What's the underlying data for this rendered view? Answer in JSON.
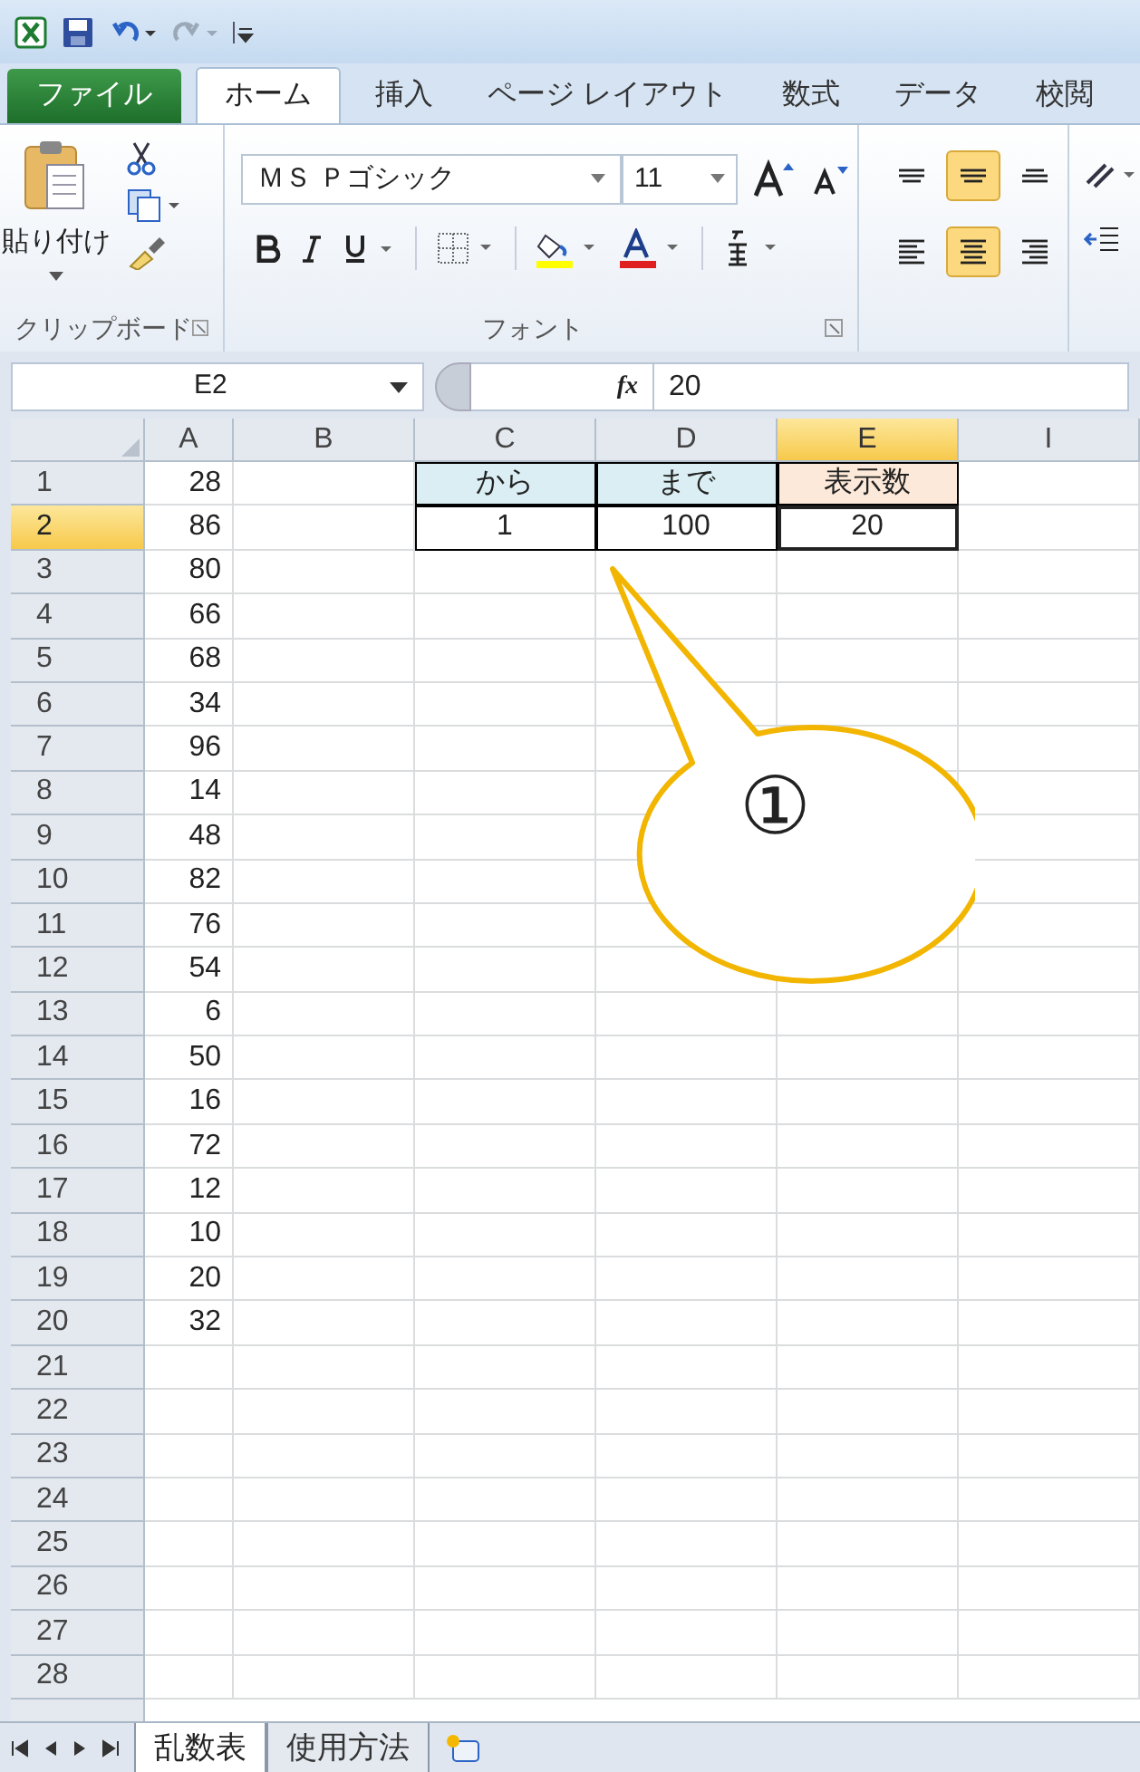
{
  "ribbon_tabs": [
    {
      "label": "ファイル",
      "kind": "file",
      "selected": false
    },
    {
      "label": "ホーム",
      "kind": "tab",
      "selected": true
    },
    {
      "label": "挿入",
      "kind": "tab",
      "selected": false
    },
    {
      "label": "ページ レイアウト",
      "kind": "tab",
      "selected": false
    },
    {
      "label": "数式",
      "kind": "tab",
      "selected": false
    },
    {
      "label": "データ",
      "kind": "tab",
      "selected": false
    },
    {
      "label": "校閲",
      "kind": "tab",
      "selected": false
    }
  ],
  "clipboard": {
    "paste_label": "貼り付け",
    "group_label": "クリップボード"
  },
  "font": {
    "name": "ＭＳ Ｐゴシック",
    "size": "11",
    "group_label": "フォント"
  },
  "alignment": [
    {
      "kind": "top",
      "selected": false
    },
    {
      "kind": "middle",
      "selected": true
    },
    {
      "kind": "bottom",
      "selected": false
    },
    {
      "kind": "left",
      "selected": false
    },
    {
      "kind": "center",
      "selected": true
    },
    {
      "kind": "right",
      "selected": false
    }
  ],
  "formula_bar": {
    "name_box": "E2",
    "function_label": "fx",
    "value": "20"
  },
  "grid": {
    "columns": [
      {
        "label": "A",
        "selected": false
      },
      {
        "label": "B",
        "selected": false
      },
      {
        "label": "C",
        "selected": false
      },
      {
        "label": "D",
        "selected": false
      },
      {
        "label": "E",
        "selected": true
      },
      {
        "label": "I",
        "selected": false
      }
    ],
    "rows": [
      {
        "label": "1",
        "selected": false,
        "cells": {
          "A": {
            "text": "28",
            "boxed": false
          },
          "C": {
            "text": "から",
            "boxed": true,
            "color": "#daeef3"
          },
          "D": {
            "text": "まで",
            "boxed": true,
            "color": "#daeef3"
          },
          "E": {
            "text": "表示数",
            "boxed": true,
            "color": "#fde9d9"
          }
        }
      },
      {
        "label": "2",
        "selected": true,
        "cells": {
          "A": {
            "text": "86",
            "boxed": false
          },
          "C": {
            "text": "1",
            "boxed": true
          },
          "D": {
            "text": "100",
            "boxed": true
          },
          "E": {
            "text": "20",
            "boxed": true,
            "selected": true
          }
        }
      },
      {
        "label": "3",
        "selected": false,
        "cells": {
          "A": {
            "text": "80",
            "boxed": false
          }
        }
      },
      {
        "label": "4",
        "selected": false,
        "cells": {
          "A": {
            "text": "66",
            "boxed": false
          }
        }
      },
      {
        "label": "5",
        "selected": false,
        "cells": {
          "A": {
            "text": "68",
            "boxed": false
          }
        }
      },
      {
        "label": "6",
        "selected": false,
        "cells": {
          "A": {
            "text": "34",
            "boxed": false
          }
        }
      },
      {
        "label": "7",
        "selected": false,
        "cells": {
          "A": {
            "text": "96",
            "boxed": false
          }
        }
      },
      {
        "label": "8",
        "selected": false,
        "cells": {
          "A": {
            "text": "14",
            "boxed": false
          }
        }
      },
      {
        "label": "9",
        "selected": false,
        "cells": {
          "A": {
            "text": "48",
            "boxed": false
          }
        }
      },
      {
        "label": "10",
        "selected": false,
        "cells": {
          "A": {
            "text": "82",
            "boxed": false
          }
        }
      },
      {
        "label": "11",
        "selected": false,
        "cells": {
          "A": {
            "text": "76",
            "boxed": false
          }
        }
      },
      {
        "label": "12",
        "selected": false,
        "cells": {
          "A": {
            "text": "54",
            "boxed": false
          }
        }
      },
      {
        "label": "13",
        "selected": false,
        "cells": {
          "A": {
            "text": "6",
            "boxed": false
          }
        }
      },
      {
        "label": "14",
        "selected": false,
        "cells": {
          "A": {
            "text": "50",
            "boxed": false
          }
        }
      },
      {
        "label": "15",
        "selected": false,
        "cells": {
          "A": {
            "text": "16",
            "boxed": false
          }
        }
      },
      {
        "label": "16",
        "selected": false,
        "cells": {
          "A": {
            "text": "72",
            "boxed": false
          }
        }
      },
      {
        "label": "17",
        "selected": false,
        "cells": {
          "A": {
            "text": "12",
            "boxed": false
          }
        }
      },
      {
        "label": "18",
        "selected": false,
        "cells": {
          "A": {
            "text": "10",
            "boxed": false
          }
        }
      },
      {
        "label": "19",
        "selected": false,
        "cells": {
          "A": {
            "text": "20",
            "boxed": false
          }
        }
      },
      {
        "label": "20",
        "selected": false,
        "cells": {
          "A": {
            "text": "32",
            "boxed": false
          }
        }
      },
      {
        "label": "21",
        "selected": false,
        "cells": {}
      },
      {
        "label": "22",
        "selected": false,
        "cells": {}
      },
      {
        "label": "23",
        "selected": false,
        "cells": {}
      },
      {
        "label": "24",
        "selected": false,
        "cells": {}
      },
      {
        "label": "25",
        "selected": false,
        "cells": {}
      },
      {
        "label": "26",
        "selected": false,
        "cells": {}
      },
      {
        "label": "27",
        "selected": false,
        "cells": {}
      },
      {
        "label": "28",
        "selected": false,
        "cells": {}
      }
    ]
  },
  "callout": {
    "text": "①"
  },
  "sheet_tabs": [
    {
      "label": "乱数表",
      "selected": true
    },
    {
      "label": "使用方法",
      "selected": false
    }
  ]
}
